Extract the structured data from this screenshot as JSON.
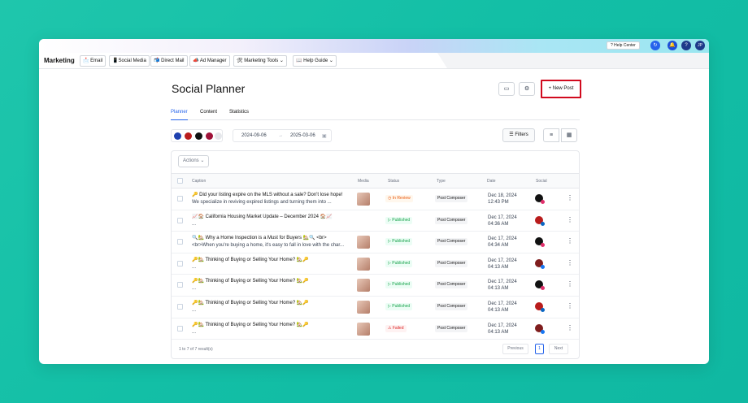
{
  "topbar": {
    "help_center": "Help Center",
    "user_initials": "JP"
  },
  "nav": {
    "brand": "Marketing",
    "items": [
      {
        "icon": "email-icon",
        "glyph": "📩",
        "label": "Email"
      },
      {
        "icon": "phone-icon",
        "glyph": "📱",
        "label": "Social Media"
      },
      {
        "icon": "mail-icon",
        "glyph": "📬",
        "label": "Direct Mail"
      },
      {
        "icon": "megaphone-icon",
        "glyph": "📣",
        "label": "Ad Manager"
      },
      {
        "icon": "tools-icon",
        "glyph": "🛠",
        "label": "Marketing Tools",
        "dropdown": true
      },
      {
        "icon": "book-icon",
        "glyph": "📖",
        "label": "Help Guide",
        "dropdown": true
      }
    ]
  },
  "page": {
    "title": "Social Planner",
    "new_post_label": "New Post",
    "tabs": [
      "Planner",
      "Content",
      "Statistics"
    ],
    "active_tab": "Planner"
  },
  "filters": {
    "date_from": "2024-09-06",
    "date_to": "2025-03-06",
    "filters_label": "Filters"
  },
  "table": {
    "actions_label": "Actions",
    "columns": [
      "Caption",
      "Media",
      "Status",
      "Type",
      "Date",
      "Social"
    ],
    "rows": [
      {
        "line1": "🔑 Did your listing expire on the MLS without a sale? Don't lose hope!",
        "line2": "We specialize in reviving expired listings and turning them into ...",
        "media": true,
        "status": "In Review",
        "type": "Post Composer",
        "date": "Dec 18, 2024",
        "time": "12:43 PM",
        "social": "instagram"
      },
      {
        "line1": "📈🏠 California Housing Market Update – December 2024 🏠📈",
        "line2": "...",
        "media": false,
        "status": "Published",
        "type": "Post Composer",
        "date": "Dec 17, 2024",
        "time": "04:36 AM",
        "social": "linkedin"
      },
      {
        "line1": "🔍🏡 Why a Home Inspection is a Must for Buyers 🏡🔍 <br>",
        "line2": "<br>When you're buying a home, it's easy to fall in love with the char...",
        "media": true,
        "status": "Published",
        "type": "Post Composer",
        "date": "Dec 17, 2024",
        "time": "04:34 AM",
        "social": "instagram"
      },
      {
        "line1": "🔑🏡 Thinking of Buying or Selling Your Home? 🏡🔑",
        "line2": "...",
        "media": true,
        "status": "Published",
        "type": "Post Composer",
        "date": "Dec 17, 2024",
        "time": "04:13 AM",
        "social": "facebook"
      },
      {
        "line1": "🔑🏡 Thinking of Buying or Selling Your Home? 🏡🔑",
        "line2": "...",
        "media": true,
        "status": "Published",
        "type": "Post Composer",
        "date": "Dec 17, 2024",
        "time": "04:13 AM",
        "social": "instagram"
      },
      {
        "line1": "🔑🏡 Thinking of Buying or Selling Your Home? 🏡🔑",
        "line2": "...",
        "media": true,
        "status": "Published",
        "type": "Post Composer",
        "date": "Dec 17, 2024",
        "time": "04:13 AM",
        "social": "linkedin"
      },
      {
        "line1": "🔑🏡 Thinking of Buying or Selling Your Home? 🏡🔑",
        "line2": "...",
        "media": true,
        "status": "Failed",
        "type": "Post Composer",
        "date": "Dec 17, 2024",
        "time": "04:13 AM",
        "social": "facebook"
      }
    ],
    "results_text": "1 to 7 of 7 result(s)",
    "previous_label": "Previous",
    "current_page": "1",
    "next_label": "Next"
  }
}
